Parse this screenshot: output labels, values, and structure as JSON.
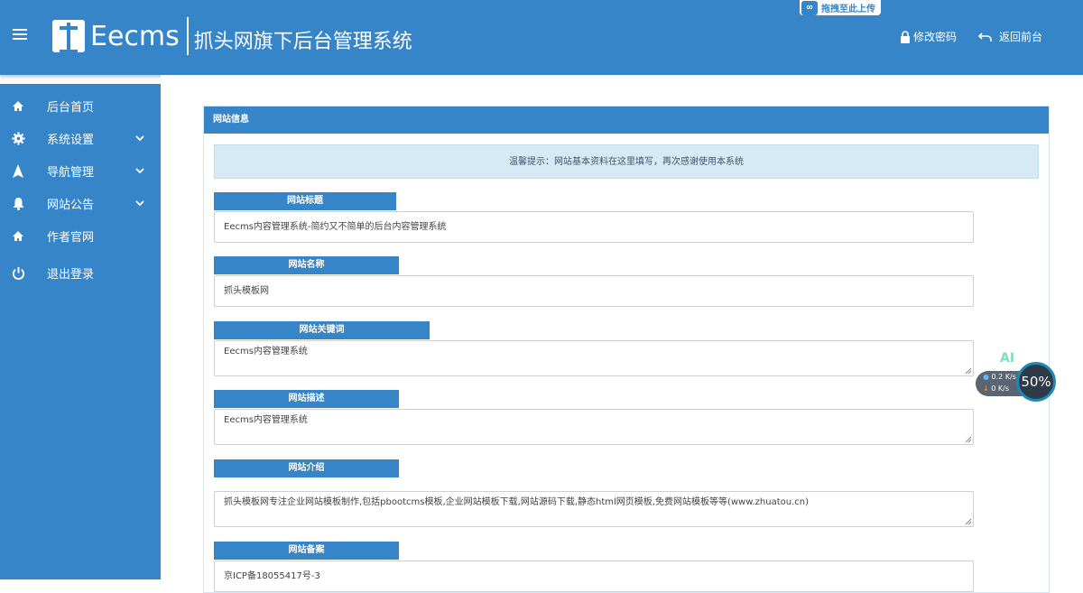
{
  "header": {
    "logo_text": "Eecms",
    "system_title": "抓头网旗下后台管理系统",
    "upload_tag": "拖拽至此上传",
    "change_password": "修改密码",
    "back_to_front": "返回前台"
  },
  "sidebar": {
    "items": [
      {
        "label": "后台首页",
        "icon": "home-icon",
        "expandable": false
      },
      {
        "label": "系统设置",
        "icon": "gear-icon",
        "expandable": true
      },
      {
        "label": "导航管理",
        "icon": "navigation-arrow-icon",
        "expandable": true
      },
      {
        "label": "网站公告",
        "icon": "bell-icon",
        "expandable": true
      },
      {
        "label": "作者官网",
        "icon": "home-icon",
        "expandable": false
      },
      {
        "label": "退出登录",
        "icon": "power-icon",
        "expandable": false
      }
    ]
  },
  "panel": {
    "title": "网站信息",
    "notice": "温馨提示：网站基本资料在这里填写，再次感谢使用本系统",
    "fields": [
      {
        "label": "网站标题",
        "value": "Eecms内容管理系统-简约又不简单的后台内容管理系统"
      },
      {
        "label": "网站名称",
        "value": "抓头模板网"
      },
      {
        "label": "网站关键词",
        "value": "Eecms内容管理系统"
      },
      {
        "label": "网站描述",
        "value": "Eecms内容管理系统"
      },
      {
        "label": "网站介绍",
        "value": "抓头模板网专注企业网站模板制作,包括pbootcms模板,企业网站模板下载,网站源码下载,静态html网页模板,免费网站模板等等(www.zhuatou.cn)"
      },
      {
        "label": "网站备案",
        "value": "京ICP备18055417号-3"
      }
    ]
  },
  "widget": {
    "ai_label": "AI",
    "upload_speed": "0.2",
    "download_speed": "0",
    "speed_unit": "K/s",
    "percent": "50%"
  },
  "colors": {
    "brand": "#3785c9",
    "notice_bg": "#d6eaf5"
  }
}
